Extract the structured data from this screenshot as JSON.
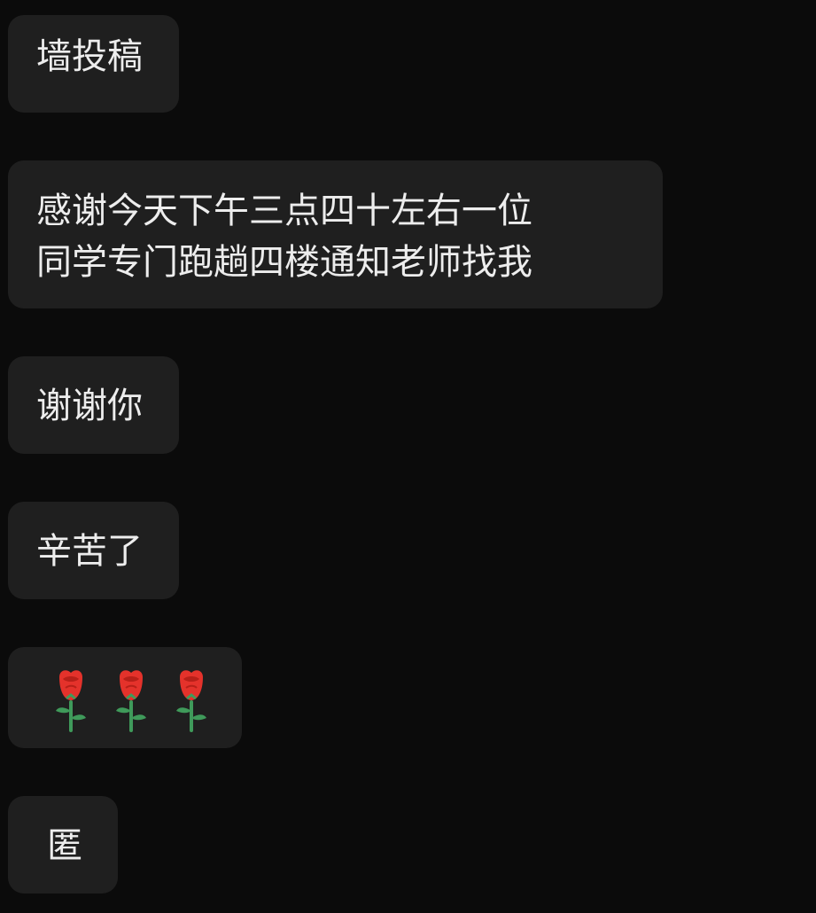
{
  "messages": [
    {
      "text": "墙投稿"
    },
    {
      "lines": [
        "感谢今天下午三点四十左右一位",
        "同学专门跑趟四楼通知老师找我"
      ]
    },
    {
      "text": "谢谢你"
    },
    {
      "text": "辛苦了"
    },
    {
      "emoji": [
        "rose-emoji",
        "rose-emoji",
        "rose-emoji"
      ]
    },
    {
      "text": "匿"
    }
  ],
  "colors": {
    "background": "#0b0b0b",
    "bubble": "#1f1f1f",
    "text": "#ededed",
    "rose_red": "#e4322b",
    "stem_green": "#3f9a5a"
  }
}
